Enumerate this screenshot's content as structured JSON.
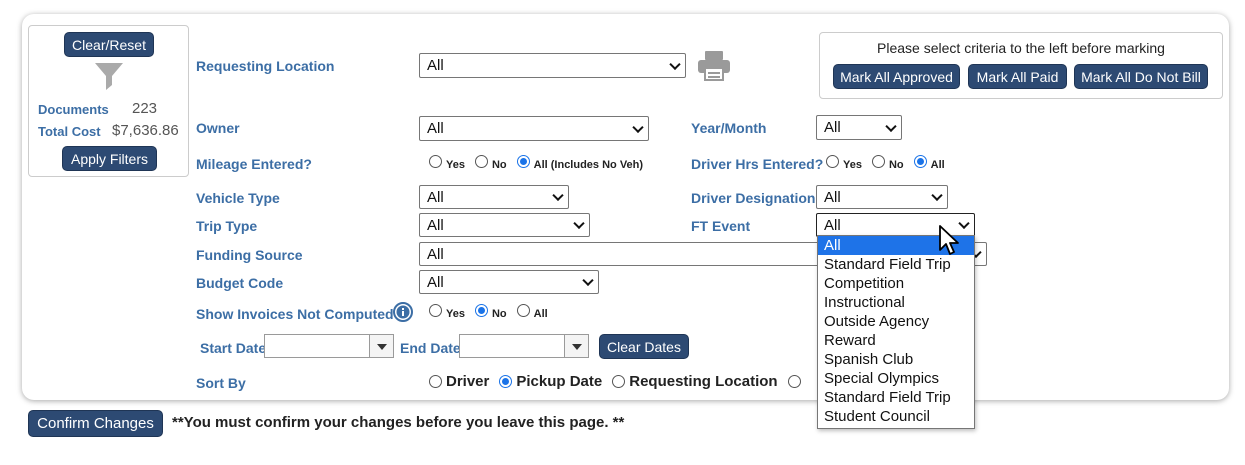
{
  "filters_summary": {
    "clear_reset": "Clear/Reset",
    "documents_label": "Documents",
    "documents_value": "223",
    "total_cost_label": "Total Cost",
    "total_cost_value": "$7,636.86",
    "apply_filters": "Apply Filters"
  },
  "requesting_location": {
    "label": "Requesting Location",
    "value": "All"
  },
  "mark_panel": {
    "message": "Please select criteria to the left before marking",
    "approved": "Mark All Approved",
    "paid": "Mark All Paid",
    "do_not_bill": "Mark All Do Not Bill"
  },
  "owner": {
    "label": "Owner",
    "value": "All"
  },
  "year_month": {
    "label": "Year/Month",
    "value": "All"
  },
  "mileage": {
    "label": "Mileage Entered?",
    "yes": "Yes",
    "no": "No",
    "all": "All (Includes No Veh)",
    "selected": "all"
  },
  "driver_hrs": {
    "label": "Driver Hrs Entered?",
    "yes": "Yes",
    "no": "No",
    "all": "All",
    "selected": "all"
  },
  "vehicle_type": {
    "label": "Vehicle Type",
    "value": "All"
  },
  "driver_designation": {
    "label": "Driver Designation",
    "value": "All"
  },
  "trip_type": {
    "label": "Trip Type",
    "value": "All"
  },
  "ft_event": {
    "label": "FT Event",
    "value": "All",
    "options": [
      "All",
      "Standard Field Trip",
      "Competition",
      "Instructional",
      "Outside Agency",
      "Reward",
      "Spanish Club",
      "Special Olympics",
      "Standard Field Trip",
      "Student Council"
    ],
    "highlighted": 0
  },
  "funding_source": {
    "label": "Funding Source",
    "value": "All"
  },
  "budget_code": {
    "label": "Budget Code",
    "value": "All"
  },
  "show_invoices": {
    "label": "Show Invoices Not Computed?",
    "yes": "Yes",
    "no": "No",
    "all": "All",
    "selected": "no"
  },
  "dates": {
    "start_label": "Start Date",
    "start_value": "",
    "end_label": "End Date",
    "end_value": "",
    "clear": "Clear Dates"
  },
  "sort_by": {
    "label": "Sort By",
    "driver": "Driver",
    "pickup_date": "Pickup Date",
    "requesting_location": "Requesting Location",
    "selected": "pickup_date"
  },
  "footer": {
    "confirm": "Confirm Changes",
    "notice": "**You must confirm your changes before you leave this page. **"
  },
  "colors": {
    "accent": "#2d4a73",
    "label": "#3c6ea5",
    "highlight": "#1e73e8"
  }
}
